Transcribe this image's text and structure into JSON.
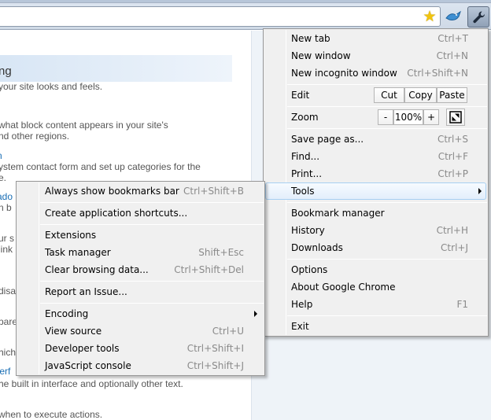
{
  "page": {
    "title": "ng",
    "lines": [
      "your site looks and feels.",
      "what block content appears in your site's",
      "nd other regions.",
      "n",
      "ystem contact form and set up categories for the",
      "e.",
      "ado",
      "n b",
      "ur s",
      "link",
      "disa",
      "pare",
      "hich",
      "terf",
      "he built in interface and optionally other text.",
      "when to execute actions."
    ]
  },
  "chrome_menu": {
    "new_tab": {
      "label": "New tab",
      "shortcut": "Ctrl+T"
    },
    "new_window": {
      "label": "New window",
      "shortcut": "Ctrl+N"
    },
    "new_incognito": {
      "label": "New incognito window",
      "shortcut": "Ctrl+Shift+N"
    },
    "edit": {
      "label": "Edit",
      "cut": "Cut",
      "copy": "Copy",
      "paste": "Paste"
    },
    "zoom": {
      "label": "Zoom",
      "minus": "-",
      "value": "100%",
      "plus": "+"
    },
    "save_page": {
      "label": "Save page as...",
      "shortcut": "Ctrl+S"
    },
    "find": {
      "label": "Find...",
      "shortcut": "Ctrl+F"
    },
    "print": {
      "label": "Print...",
      "shortcut": "Ctrl+P"
    },
    "tools": {
      "label": "Tools"
    },
    "bookmark_manager": {
      "label": "Bookmark manager"
    },
    "history": {
      "label": "History",
      "shortcut": "Ctrl+H"
    },
    "downloads": {
      "label": "Downloads",
      "shortcut": "Ctrl+J"
    },
    "options": {
      "label": "Options"
    },
    "about": {
      "label": "About Google Chrome"
    },
    "help": {
      "label": "Help",
      "shortcut": "F1"
    },
    "exit": {
      "label": "Exit"
    }
  },
  "tools_menu": {
    "always_show_bookmarks": {
      "label": "Always show bookmarks bar",
      "shortcut": "Ctrl+Shift+B"
    },
    "create_shortcuts": {
      "label": "Create application shortcuts..."
    },
    "extensions": {
      "label": "Extensions"
    },
    "task_manager": {
      "label": "Task manager",
      "shortcut": "Shift+Esc"
    },
    "clear_data": {
      "label": "Clear browsing data...",
      "shortcut": "Ctrl+Shift+Del"
    },
    "report_issue": {
      "label": "Report an Issue..."
    },
    "encoding": {
      "label": "Encoding"
    },
    "view_source": {
      "label": "View source",
      "shortcut": "Ctrl+U"
    },
    "developer_tools": {
      "label": "Developer tools",
      "shortcut": "Ctrl+Shift+I"
    },
    "javascript_console": {
      "label": "JavaScript console",
      "shortcut": "Ctrl+Shift+J"
    }
  },
  "icons": {
    "bookmark_star": "star-icon",
    "sync": "bird-icon",
    "wrench": "wrench-icon",
    "fullscreen": "fullscreen-icon"
  },
  "colors": {
    "link": "#1a6fb5",
    "highlight_border": "#a8d0f2",
    "menu_bg": "#f0f0f0"
  }
}
